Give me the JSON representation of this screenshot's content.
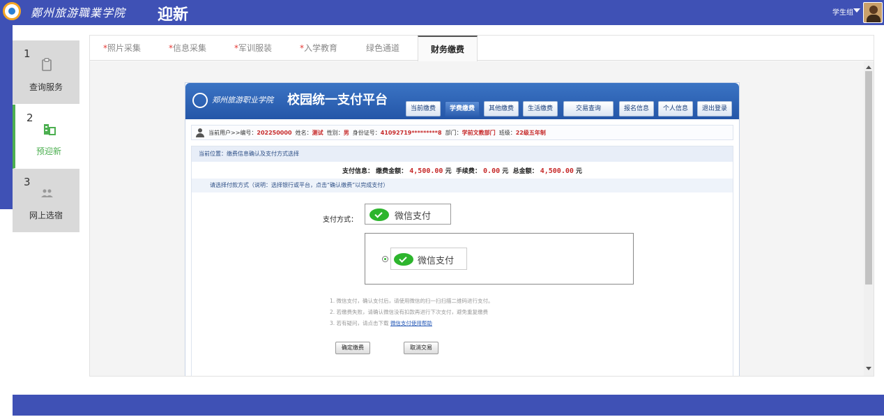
{
  "header": {
    "school_name": "鄭州旅游職業学院",
    "app_title": "迎新",
    "user_label": "学生组"
  },
  "sidebar": {
    "steps": [
      {
        "num": "1",
        "label": "查询服务",
        "icon": "clipboard-icon",
        "active": false
      },
      {
        "num": "2",
        "label": "预迎新",
        "icon": "building-icon",
        "active": true
      },
      {
        "num": "3",
        "label": "网上选宿",
        "icon": "people-icon",
        "active": false
      }
    ]
  },
  "tabs": [
    {
      "label": "照片采集",
      "required": true
    },
    {
      "label": "信息采集",
      "required": true
    },
    {
      "label": "军训服装",
      "required": true
    },
    {
      "label": "入学教育",
      "required": true
    },
    {
      "label": "绿色通道",
      "required": false
    },
    {
      "label": "财务缴费",
      "required": false,
      "active": true
    }
  ],
  "payment": {
    "school_name": "郑州旅游职业学院",
    "platform_title": "校园统一支付平台",
    "nav": [
      "当前缴费",
      "学费缴费",
      "其他缴费",
      "生活缴费",
      "交易查询",
      "报名信息",
      "个人信息",
      "退出登录"
    ],
    "nav_active": "学费缴费",
    "user": {
      "prefix": "当前用户>>编号：",
      "id": "202250000",
      "name_label": "姓名：",
      "name": "测试",
      "gender_label": "性别：",
      "gender": "男",
      "idcard_label": "身份证号：",
      "idcard": "41092719*********8",
      "dept_label": "部门：",
      "dept": "学前文教部门",
      "class_label": "班级：",
      "class": "22级五年制"
    },
    "location": "当前位置：缴费信息确认及支付方式选择",
    "info": {
      "label": "支付信息：",
      "due_label": "缴费金额：",
      "due": "4,500.00",
      "fee_label": "手续费：",
      "fee": "0.00",
      "total_label": "总金额：",
      "total": "4,500.00",
      "unit": "元"
    },
    "choose_text": "请选择付款方式（说明：选择银行或平台，点击“确认缴费”以完成支付）",
    "method_label": "支付方式：",
    "wechat_label": "微信支付",
    "notes": [
      "1. 微信支付，确认支付后，请使用微信的扫一扫扫描二维码进行支付。",
      "2. 若缴费失败，请确认微信没有扣款再进行下次支付，避免重复缴费",
      "3. 若有疑问，请点击下载"
    ],
    "help_link": "微信支付使用帮助",
    "confirm_label": "确定缴费",
    "cancel_label": "取消交易"
  }
}
